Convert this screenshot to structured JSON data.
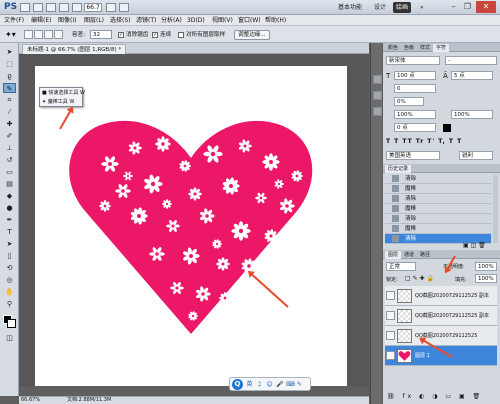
{
  "app": {
    "logo": "PS",
    "zoom": "66.7"
  },
  "workspaces": [
    "基本功能",
    "设计",
    "绘画"
  ],
  "menu": [
    "文件(F)",
    "编辑(E)",
    "图像(I)",
    "图层(L)",
    "选择(S)",
    "滤镜(T)",
    "分析(A)",
    "3D(D)",
    "视图(V)",
    "窗口(W)",
    "帮助(H)"
  ],
  "options": {
    "tolerance_label": "容差:",
    "tolerance_value": "32",
    "antialias": "消除锯齿",
    "contiguous": "连续",
    "sample_all": "对所有图层取样",
    "refine": "调整边缘..."
  },
  "document_tab": "未标题-1 @ 66.7% (图层 1,RGB/8) *",
  "tool_flyout": [
    {
      "label": "快速选择工具",
      "key": "W"
    },
    {
      "label": "魔棒工具",
      "key": "W"
    }
  ],
  "character_panel": {
    "tabs": [
      "颜色",
      "色板",
      "样式",
      "字符"
    ],
    "font_family": "新宋体",
    "font_style": "-",
    "font_size": "100 点",
    "leading": "5 点",
    "tracking": "0%",
    "kerning": "0",
    "vscale": "100%",
    "hscale": "100%",
    "baseline": "0 点",
    "language": "美国英语",
    "aa": "锐利"
  },
  "history": {
    "tab": "历史记录",
    "items": [
      "清除",
      "魔棒",
      "清除",
      "魔棒",
      "清除",
      "魔棒",
      "清除"
    ],
    "selected_index": 6
  },
  "layers": {
    "tabs": [
      "图层",
      "通道",
      "路径"
    ],
    "blend_mode": "正常",
    "opacity_label": "不透明度:",
    "opacity": "100%",
    "fill_label": "填充:",
    "fill": "100%",
    "lock_label": "锁定:",
    "items": [
      {
        "name": "QQ截图20200729112525 副本"
      },
      {
        "name": "QQ截图20200729112525 副本"
      },
      {
        "name": "QQ截图20200729112525"
      },
      {
        "name": "图层 1"
      }
    ]
  },
  "status": {
    "zoom": "66.67%",
    "doc": "文档:2.88M/11.3M"
  },
  "floatbar_icons": [
    "英",
    "ℷ",
    "☺",
    "🎤",
    "⌨",
    "✎"
  ],
  "colors": {
    "heart": "#ec1766",
    "selection": "#3d86dc",
    "arrow": "#e84a2e"
  }
}
